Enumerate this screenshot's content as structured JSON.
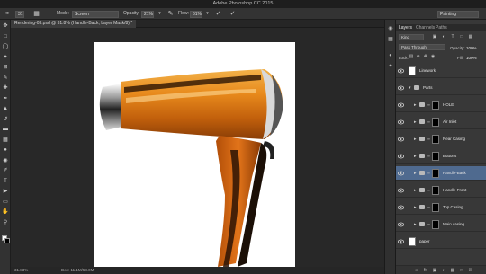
{
  "app": {
    "title": "Adobe Photoshop CC 2015"
  },
  "options": {
    "brush_size": "31",
    "mode_label": "Mode:",
    "mode_value": "Screen",
    "opacity_label": "Opacity:",
    "opacity_value": "21%",
    "flow_label": "Flow:",
    "flow_value": "61%",
    "workspace": "Painting"
  },
  "document": {
    "tab_label": "Rendering-03.psd @ 31.8% (Handle-Back, Layer Mask/8) *",
    "zoom": "31.83%",
    "doc_info": "Doc: 11.1M/58.0M"
  },
  "tools": [
    "move-tool",
    "marquee-tool",
    "lasso-tool",
    "quick-select-tool",
    "crop-tool",
    "eyedropper-tool",
    "healing-tool",
    "brush-tool",
    "stamp-tool",
    "history-brush-tool",
    "eraser-tool",
    "gradient-tool",
    "blur-tool",
    "dodge-tool",
    "pen-tool",
    "type-tool",
    "path-select-tool",
    "shape-tool",
    "hand-tool",
    "zoom-tool"
  ],
  "layers_panel": {
    "tabs": [
      "Layers",
      "Channels",
      "Paths"
    ],
    "filter_kind": "Kind",
    "blend_mode": "Pass Through",
    "opacity_label": "Opacity:",
    "opacity_value": "100%",
    "lock_label": "Lock:",
    "fill_label": "Fill:",
    "fill_value": "100%",
    "layers": [
      {
        "name": "Linework",
        "type": "layer",
        "thumb": "white",
        "indent": 0,
        "selected": false
      },
      {
        "name": "Parts",
        "type": "group-open",
        "thumb": "none",
        "indent": 0,
        "selected": false
      },
      {
        "name": "HOLE",
        "type": "group",
        "thumb": "black",
        "indent": 1,
        "selected": false
      },
      {
        "name": "Air Inlet",
        "type": "group",
        "thumb": "black",
        "indent": 1,
        "selected": false
      },
      {
        "name": "Rear Casing",
        "type": "group",
        "thumb": "black",
        "indent": 1,
        "selected": false
      },
      {
        "name": "Buttons",
        "type": "group",
        "thumb": "black",
        "indent": 1,
        "selected": false
      },
      {
        "name": "Handle-Back",
        "type": "group",
        "thumb": "black",
        "indent": 1,
        "selected": true
      },
      {
        "name": "Handle-Front",
        "type": "group",
        "thumb": "black",
        "indent": 1,
        "selected": false
      },
      {
        "name": "Top Casing",
        "type": "group",
        "thumb": "black",
        "indent": 1,
        "selected": false
      },
      {
        "name": "Main casing",
        "type": "group",
        "thumb": "black",
        "indent": 1,
        "selected": false
      },
      {
        "name": "paper",
        "type": "layer",
        "thumb": "white",
        "indent": 0,
        "selected": false
      }
    ]
  },
  "colors": {
    "selection": "#4f6a8f",
    "foreground": "#ffffff",
    "background": "#000000",
    "dryer_orange": "#e47a14"
  }
}
